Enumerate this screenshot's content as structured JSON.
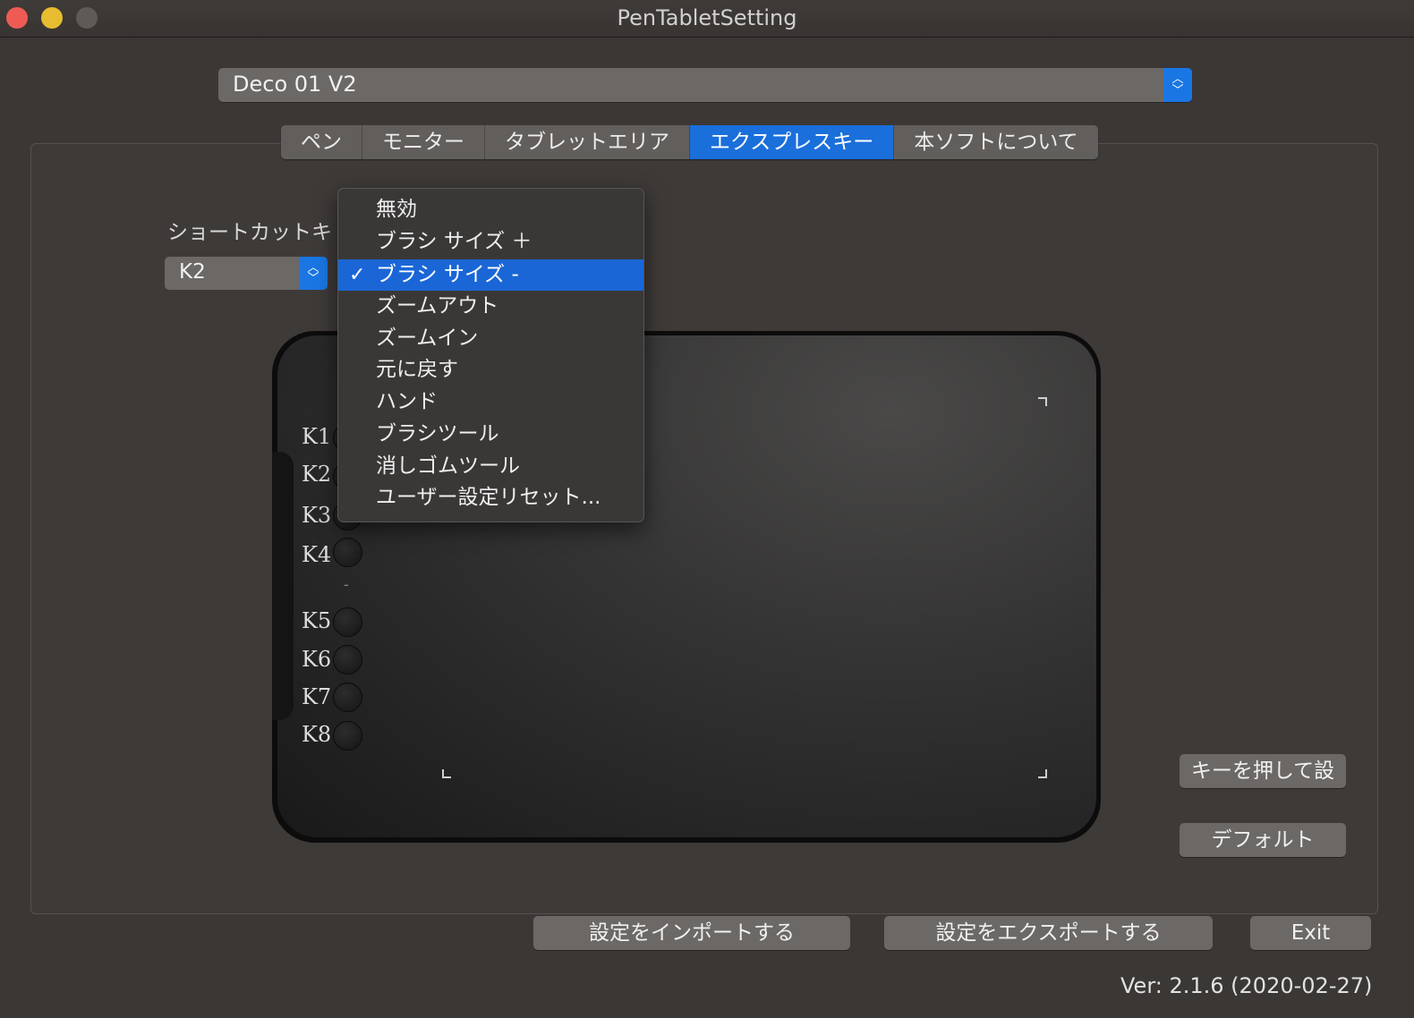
{
  "window": {
    "title": "PenTabletSetting"
  },
  "device": {
    "selected": "Deco 01 V2"
  },
  "tabs": [
    {
      "label": "ペン",
      "active": false
    },
    {
      "label": "モニター",
      "active": false
    },
    {
      "label": "タブレットエリア",
      "active": false
    },
    {
      "label": "エクスプレスキー",
      "active": true
    },
    {
      "label": "本ソフトについて",
      "active": false
    }
  ],
  "shortcut": {
    "label": "ショートカットキ",
    "selected_key": "K2"
  },
  "menu": {
    "items": [
      "無効",
      "ブラシ サイズ ＋",
      "ブラシ サイズ -",
      "ズームアウト",
      "ズームイン",
      "元に戻す",
      "ハンド",
      "ブラシツール",
      "消しゴムツール",
      "ユーザー設定リセット..."
    ],
    "selected_index": 2,
    "check_glyph": "✓"
  },
  "tablet": {
    "keys": [
      "K1",
      "K2",
      "K3",
      "K4",
      "K5",
      "K6",
      "K7",
      "K8"
    ],
    "divider": "-"
  },
  "buttons": {
    "press_key": "キーを押して設",
    "default": "デフォルト",
    "import": "設定をインポートする",
    "export": "設定をエクスポートする",
    "exit": "Exit"
  },
  "version": "Ver: 2.1.6 (2020-02-27)",
  "colors": {
    "accent": "#1a6fdb",
    "window_bg": "#3b3735",
    "control_bg": "#6c6865"
  }
}
